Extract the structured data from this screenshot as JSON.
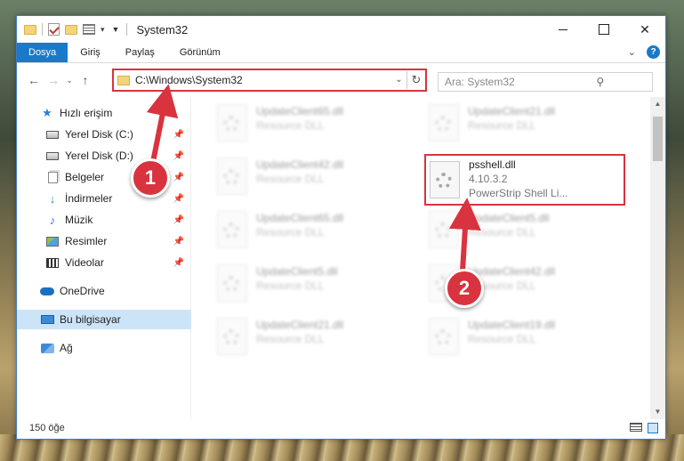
{
  "window": {
    "title": "System32"
  },
  "ribbon": {
    "tabs": [
      {
        "label": "Dosya",
        "active": true
      },
      {
        "label": "Giriş",
        "active": false
      },
      {
        "label": "Paylaş",
        "active": false
      },
      {
        "label": "Görünüm",
        "active": false
      }
    ],
    "help_label": "?"
  },
  "nav": {
    "address": "C:\\Windows\\System32",
    "search_placeholder": "Ara: System32"
  },
  "sidebar": {
    "items": [
      {
        "label": "Hızlı erişim",
        "icon": "star-icon",
        "pinned": false
      },
      {
        "label": "Yerel Disk (C:)",
        "icon": "drive-icon",
        "pinned": true
      },
      {
        "label": "Yerel Disk (D:)",
        "icon": "drive-icon",
        "pinned": true
      },
      {
        "label": "Belgeler",
        "icon": "documents-icon",
        "pinned": true
      },
      {
        "label": "İndirmeler",
        "icon": "download-icon",
        "pinned": true
      },
      {
        "label": "Müzik",
        "icon": "music-icon",
        "pinned": true
      },
      {
        "label": "Resimler",
        "icon": "pictures-icon",
        "pinned": true
      },
      {
        "label": "Videolar",
        "icon": "videos-icon",
        "pinned": true
      },
      {
        "label": "OneDrive",
        "icon": "onedrive-icon",
        "pinned": false
      },
      {
        "label": "Bu bilgisayar",
        "icon": "computer-icon",
        "pinned": false,
        "selected": true
      },
      {
        "label": "Ağ",
        "icon": "network-icon",
        "pinned": false
      }
    ]
  },
  "files": [
    {
      "name": "UpdateClient65.dll",
      "sub": "Resource DLL",
      "blurred": true
    },
    {
      "name": "UpdateClient21.dll",
      "sub": "Resource DLL",
      "blurred": true
    },
    {
      "name": "UpdateClient42.dll",
      "sub": "Resource DLL",
      "blurred": true
    },
    {
      "name": "psshell.dll",
      "version": "4.10.3.2",
      "sub": "PowerStrip Shell Li...",
      "blurred": false,
      "highlighted": true
    },
    {
      "name": "UpdateClient65.dll",
      "sub": "Resource DLL",
      "blurred": true
    },
    {
      "name": "UpdateClient5.dll",
      "sub": "Resource DLL",
      "blurred": true
    },
    {
      "name": "UpdateClient5.dll",
      "sub": "Resource DLL",
      "blurred": true
    },
    {
      "name": "UpdateClient42.dll",
      "sub": "Resource DLL",
      "blurred": true
    },
    {
      "name": "UpdateClient21.dll",
      "sub": "Resource DLL",
      "blurred": true
    },
    {
      "name": "UpdateClient19.dll",
      "sub": "Resource DLL",
      "blurred": true
    }
  ],
  "status": {
    "count": "150 öğe"
  },
  "callouts": {
    "one": "1",
    "two": "2"
  },
  "colors": {
    "accent": "#1979ca",
    "highlight_red": "#d9333f",
    "selected_bg": "#cce4f7"
  }
}
